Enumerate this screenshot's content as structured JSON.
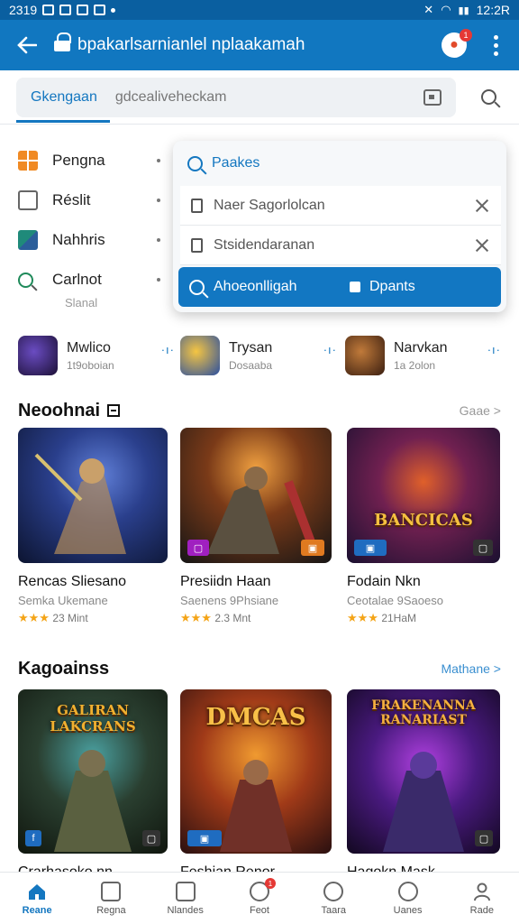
{
  "status_bar": {
    "time": "2319",
    "clock": "12:2R"
  },
  "app_bar": {
    "title": "bpakarlsarnianlel nplaakamah",
    "back_icon": "arrow-left-icon",
    "notif_count": "1"
  },
  "search": {
    "tab_label": "Gkengaan",
    "query": "gdcealiveheckam"
  },
  "categories": [
    {
      "label": "Pengna",
      "icon": "grid-icon",
      "color": "#f08a24"
    },
    {
      "label": "Réslit",
      "icon": "window-icon",
      "color": "#666666"
    },
    {
      "label": "Nahhris",
      "icon": "image-icon",
      "color": "#1f8a7a"
    },
    {
      "label": "Carlnot",
      "sub": "Slanal",
      "icon": "search-icon",
      "color": "#1f8a5a"
    }
  ],
  "popup": {
    "header": "Paakes",
    "rows": [
      {
        "text": "Naer Sagorlolcan"
      },
      {
        "text": "Stsidendaranan"
      }
    ],
    "btn_left": "Ahoeonlligah",
    "btn_right": "Dpants"
  },
  "featured": [
    {
      "name": "Mwlico",
      "sub": "1t9oboian"
    },
    {
      "name": "Trysan",
      "sub": "Dosaaba"
    },
    {
      "name": "Narvkan",
      "sub": "1a 2olon"
    }
  ],
  "section1": {
    "title": "Neoohnai",
    "more": "Gaae >",
    "cards": [
      {
        "name": "Rencas Sliesano",
        "sub": "Semka Ukemane",
        "rating": "23 Mint",
        "tag": ""
      },
      {
        "name": "Presiidn Haan",
        "sub": "Saenens 9Phsiane",
        "rating": "2.3 Mnt",
        "tag": ""
      },
      {
        "name": "Fodain Nkn",
        "sub": "Ceotalae 9Saoeso",
        "rating": "21HaM",
        "tag": "",
        "art_title": "BANCICAS"
      }
    ]
  },
  "section2": {
    "title": "Kagoainss",
    "more": "Mathane >",
    "cards": [
      {
        "name": "Crarhasoko nn",
        "art_title": "GALIRAN LAKCRANS"
      },
      {
        "name": "Feshian Renor",
        "art_title": "DMCAS"
      },
      {
        "name": "Hagokn Mask",
        "art_title": "FRAKENANNA RANARIAST"
      }
    ]
  },
  "bottom_nav": [
    {
      "label": "Reane",
      "icon": "home-icon",
      "active": true
    },
    {
      "label": "Regna",
      "icon": "list-icon"
    },
    {
      "label": "Nlandes",
      "icon": "inbox-icon"
    },
    {
      "label": "Feot",
      "icon": "clock-icon",
      "badge": "1"
    },
    {
      "label": "Taara",
      "icon": "compass-icon"
    },
    {
      "label": "Uanes",
      "icon": "chat-icon"
    },
    {
      "label": "Rade",
      "icon": "person-icon"
    }
  ],
  "colors": {
    "primary": "#1177c0",
    "status": "#0a5fa0",
    "star": "#f4a417",
    "badge": "#e53935"
  }
}
